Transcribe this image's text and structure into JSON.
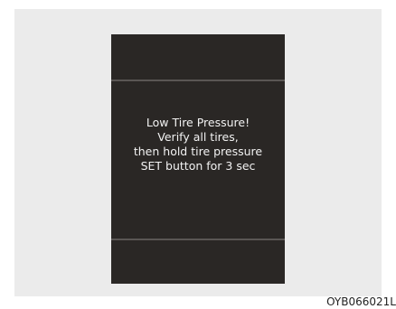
{
  "display": {
    "message_lines": [
      "Low Tire Pressure!",
      "Verify all tires,",
      "then hold tire pressure",
      "SET button for 3 sec"
    ]
  },
  "figure_code": "OYB066021L"
}
